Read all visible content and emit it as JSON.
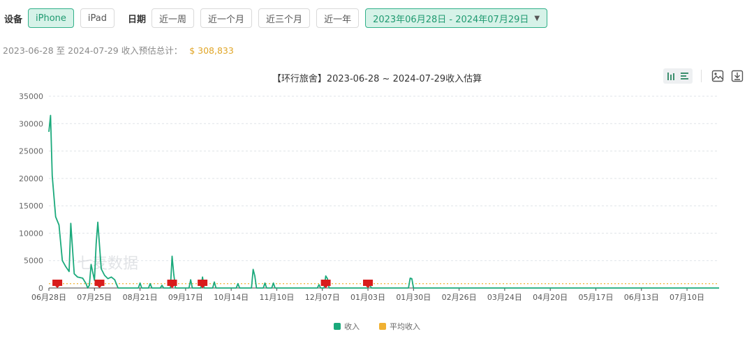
{
  "filters": {
    "device_label": "设备",
    "devices": [
      "iPhone",
      "iPad"
    ],
    "active_device": "iPhone",
    "date_label": "日期",
    "ranges": [
      "近一周",
      "近一个月",
      "近三个月",
      "近一年"
    ],
    "date_range": "2023年06月28日 - 2024年07月29日"
  },
  "summary": {
    "text": "2023-06-28 至 2024-07-29 收入预估总计：",
    "total": "$ 308,833"
  },
  "toolbox": [
    "bar-chart-icon",
    "list-icon",
    "image-icon",
    "download-icon"
  ],
  "watermark": "七麦数据",
  "chart_data": {
    "type": "line",
    "title": "【环行旅舍】2023-06-28 ~ 2024-07-29收入估算",
    "x_tick_labels": [
      "06月28日",
      "07月25日",
      "08月21日",
      "09月17日",
      "10月14日",
      "11月10日",
      "12月07日",
      "01月03日",
      "01月30日",
      "02月26日",
      "03月24日",
      "04月20日",
      "05月17日",
      "06月13日",
      "07月10日"
    ],
    "ylim": [
      0,
      35000
    ],
    "y_ticks": [
      0,
      5000,
      10000,
      15000,
      20000,
      25000,
      30000,
      35000
    ],
    "grid": true,
    "legend_position": "bottom",
    "colors": {
      "revenue": "#1aa97b",
      "average": "#f0b132",
      "marker": "#d91c1c"
    },
    "series": [
      {
        "name": "收入",
        "points": [
          [
            "2023-06-28",
            28500
          ],
          [
            "2023-06-29",
            31500
          ],
          [
            "2023-06-30",
            20500
          ],
          [
            "2023-07-02",
            13000
          ],
          [
            "2023-07-04",
            11500
          ],
          [
            "2023-07-06",
            5000
          ],
          [
            "2023-07-08",
            3900
          ],
          [
            "2023-07-10",
            3000
          ],
          [
            "2023-07-11",
            11800
          ],
          [
            "2023-07-13",
            2600
          ],
          [
            "2023-07-15",
            2000
          ],
          [
            "2023-07-18",
            1800
          ],
          [
            "2023-07-20",
            800
          ],
          [
            "2023-07-21",
            0
          ],
          [
            "2023-07-22",
            500
          ],
          [
            "2023-07-23",
            4300
          ],
          [
            "2023-07-25",
            1400
          ],
          [
            "2023-07-26",
            8000
          ],
          [
            "2023-07-27",
            12000
          ],
          [
            "2023-07-29",
            3500
          ],
          [
            "2023-07-31",
            2300
          ],
          [
            "2023-08-02",
            1700
          ],
          [
            "2023-08-04",
            2000
          ],
          [
            "2023-08-06",
            1500
          ],
          [
            "2023-08-08",
            0
          ],
          [
            "2023-08-20",
            0
          ],
          [
            "2023-08-21",
            900
          ],
          [
            "2023-08-22",
            0
          ],
          [
            "2023-08-26",
            0
          ],
          [
            "2023-08-27",
            800
          ],
          [
            "2023-08-28",
            0
          ],
          [
            "2023-09-02",
            0
          ],
          [
            "2023-09-03",
            500
          ],
          [
            "2023-09-04",
            0
          ],
          [
            "2023-09-08",
            0
          ],
          [
            "2023-09-09",
            5800
          ],
          [
            "2023-09-10",
            2500
          ],
          [
            "2023-09-11",
            0
          ],
          [
            "2023-09-19",
            0
          ],
          [
            "2023-09-20",
            1500
          ],
          [
            "2023-09-21",
            0
          ],
          [
            "2023-09-26",
            0
          ],
          [
            "2023-09-27",
            2000
          ],
          [
            "2023-09-28",
            0
          ],
          [
            "2023-10-03",
            0
          ],
          [
            "2023-10-04",
            1100
          ],
          [
            "2023-10-05",
            0
          ],
          [
            "2023-10-17",
            0
          ],
          [
            "2023-10-18",
            800
          ],
          [
            "2023-10-19",
            0
          ],
          [
            "2023-10-26",
            0
          ],
          [
            "2023-10-27",
            3400
          ],
          [
            "2023-10-28",
            2200
          ],
          [
            "2023-10-29",
            0
          ],
          [
            "2023-11-02",
            0
          ],
          [
            "2023-11-03",
            900
          ],
          [
            "2023-11-04",
            0
          ],
          [
            "2023-11-07",
            0
          ],
          [
            "2023-11-08",
            900
          ],
          [
            "2023-11-09",
            0
          ],
          [
            "2023-12-04",
            0
          ],
          [
            "2023-12-05",
            600
          ],
          [
            "2023-12-06",
            0
          ],
          [
            "2023-12-08",
            0
          ],
          [
            "2023-12-09",
            2200
          ],
          [
            "2023-12-10",
            1700
          ],
          [
            "2023-12-11",
            0
          ],
          [
            "2024-01-03",
            0
          ],
          [
            "2024-01-04",
            700
          ],
          [
            "2024-01-05",
            0
          ],
          [
            "2024-01-27",
            0
          ],
          [
            "2024-01-28",
            1800
          ],
          [
            "2024-01-29",
            1700
          ],
          [
            "2024-01-30",
            0
          ],
          [
            "2024-07-29",
            0
          ]
        ]
      },
      {
        "name": "平均收入",
        "value": 800
      }
    ],
    "markers": [
      "2023-07-03",
      "2023-07-28",
      "2023-09-09",
      "2023-09-27",
      "2023-12-09",
      "2024-01-03"
    ]
  }
}
